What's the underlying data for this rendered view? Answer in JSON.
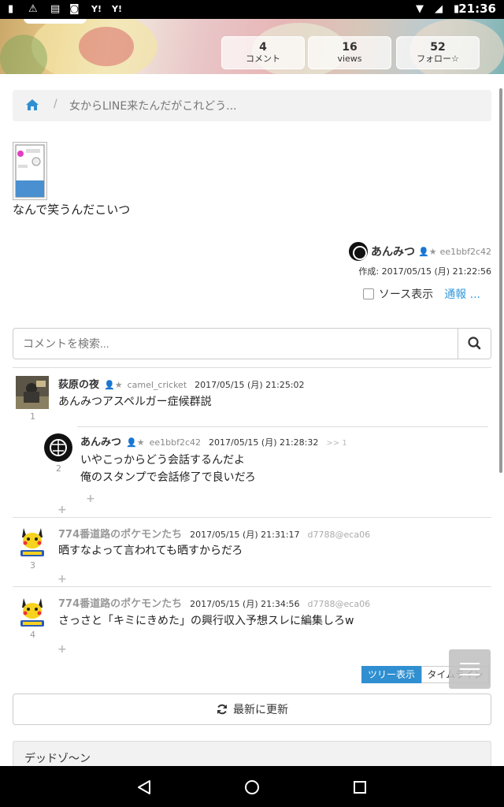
{
  "status_bar": {
    "time": "21:36",
    "icons": [
      "battery-alert-icon",
      "warning-icon",
      "sim-icon",
      "incognito-icon",
      "yahoo-icon",
      "yahoo-icon",
      "wifi-icon",
      "signal-icon",
      "battery-icon"
    ]
  },
  "header": {
    "stats": [
      {
        "value": "4",
        "label": "コメント"
      },
      {
        "value": "16",
        "label": "views"
      },
      {
        "value": "52",
        "label": "フォロー☆"
      }
    ]
  },
  "breadcrumb": {
    "home_icon": "home-icon",
    "separator": "/",
    "current": "女からLINE来たんだがこれどう..."
  },
  "post": {
    "body": "なんで笑うんだこいつ",
    "author": {
      "name": "あんみつ",
      "id": "ee1bbf2c42"
    },
    "created": "作成: 2017/05/15 (月) 21:22:56",
    "source_label": "ソース表示",
    "report_label": "通報 ..."
  },
  "search": {
    "placeholder": "コメントを検索..."
  },
  "comments": [
    {
      "num": "1",
      "name": "荻原の夜",
      "uid": "camel_cricket",
      "date": "2017/05/15 (月) 21:25:02",
      "text": "あんみつアスペルガー症候群説"
    },
    {
      "num": "2",
      "name": "あんみつ",
      "uid": "ee1bbf2c42",
      "date": "2017/05/15 (月) 21:28:32",
      "ref": ">> 1",
      "text_line1": "いやこっからどう会話するんだよ",
      "text_line2": "俺のスタンプで会話修了で良いだろ"
    },
    {
      "num": "3",
      "name": "774番道路のポケモンたち",
      "date": "2017/05/15 (月) 21:31:17",
      "id": "d7788@eca06",
      "text": "晒すなよって言われても晒すからだろ"
    },
    {
      "num": "4",
      "name": "774番道路のポケモンたち",
      "date": "2017/05/15 (月) 21:34:56",
      "id": "d7788@eca06",
      "text": "さっさと「キミにきめた」の興行収入予想スレに編集しろw"
    }
  ],
  "plus_label": "+",
  "view_toggle": {
    "tree": "ツリー表示",
    "timeline": "タイムライン"
  },
  "refresh": {
    "label": "最新に更新"
  },
  "section": {
    "title": "デッドゾ〜ン"
  },
  "colors": {
    "accent": "#2f8fd0",
    "link": "#3399dd"
  }
}
